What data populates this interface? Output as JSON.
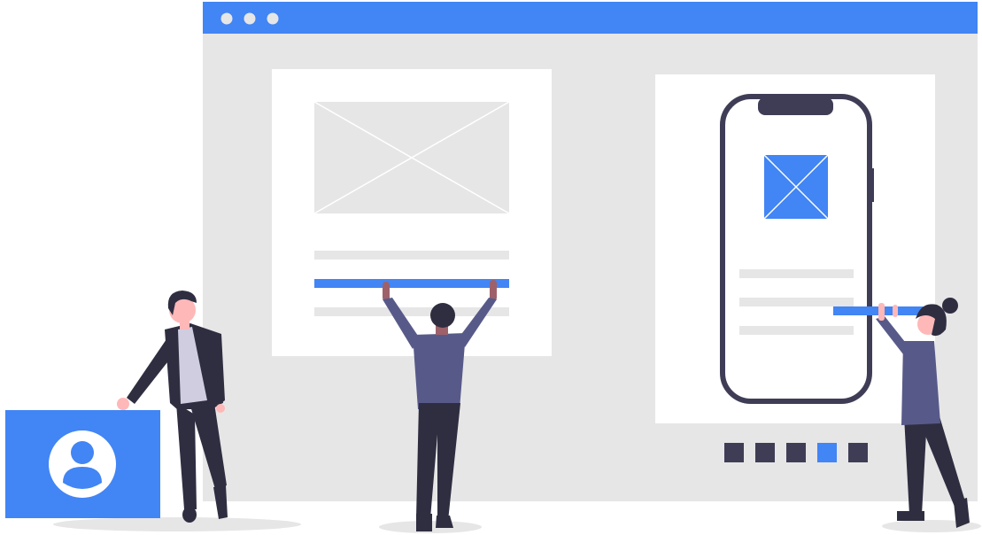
{
  "colors": {
    "accent": "#4285F4",
    "window_bg": "#E6E6E6",
    "panel": "#FFFFFF",
    "placeholder_gray": "#E6E6E6",
    "dark": "#3F3D56",
    "dark_clothing": "#2F2E41",
    "shirt_purple": "#575A89",
    "skin": "#FFB8B8"
  },
  "window": {
    "traffic_dots": [
      "dot",
      "dot",
      "dot"
    ]
  },
  "carousel": {
    "count": 5,
    "active_index": 3
  },
  "icons": {
    "desktop_image": "image-placeholder-icon",
    "mobile_image": "image-placeholder-icon",
    "profile": "user-avatar-icon"
  }
}
